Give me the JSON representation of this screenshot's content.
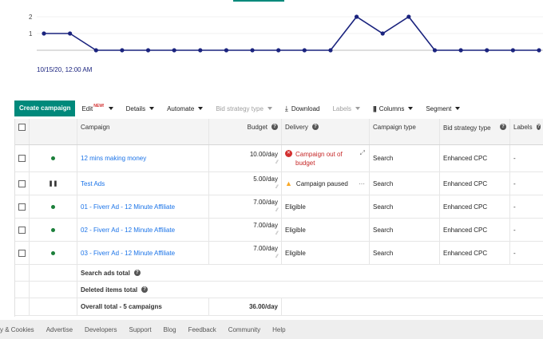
{
  "chart": {
    "y_ticks": [
      "2",
      "1"
    ],
    "values": [
      1,
      1,
      0,
      0,
      0,
      0,
      0,
      0,
      0,
      0,
      0,
      0,
      2,
      1,
      2,
      0,
      0,
      0,
      0,
      0
    ],
    "date_label": "10/15/20, 12:00 AM",
    "line_color": "#1a237e"
  },
  "toolbar": {
    "create_label": "Create campaign",
    "edit_label": "Edit",
    "edit_badge": "NEW!",
    "details_label": "Details",
    "automate_label": "Automate",
    "bid_strategy_label": "Bid strategy type",
    "download_label": "Download",
    "labels_label": "Labels",
    "columns_label": "Columns",
    "segment_label": "Segment"
  },
  "table": {
    "headers": {
      "campaign": "Campaign",
      "budget": "Budget",
      "delivery": "Delivery",
      "type": "Campaign type",
      "bid": "Bid strategy type",
      "labels": "Labels"
    },
    "rows": [
      {
        "name": "12 mins making money",
        "budget": "10.00/day",
        "delivery": "Campaign out of budget",
        "type": "Search",
        "bid": "Enhanced CPC",
        "labels": "-"
      },
      {
        "name": "Test Ads",
        "budget": "5.00/day",
        "delivery": "Campaign paused",
        "type": "Search",
        "bid": "Enhanced CPC",
        "labels": "-"
      },
      {
        "name": "01 - Fiverr Ad - 12 Minute Affiliate",
        "budget": "7.00/day",
        "delivery": "Eligible",
        "type": "Search",
        "bid": "Enhanced CPC",
        "labels": "-"
      },
      {
        "name": "02 - Fiverr Ad - 12 Minute Affiliate",
        "budget": "7.00/day",
        "delivery": "Eligible",
        "type": "Search",
        "bid": "Enhanced CPC",
        "labels": "-"
      },
      {
        "name": "03 - Fiverr Ad - 12 Minute Affiliate",
        "budget": "7.00/day",
        "delivery": "Eligible",
        "type": "Search",
        "bid": "Enhanced CPC",
        "labels": "-"
      }
    ],
    "summary": {
      "search_total": "Search ads total",
      "deleted_total": "Deleted items total",
      "overall_total": "Overall total - 5 campaigns",
      "overall_budget": "36.00/day"
    }
  },
  "footer": {
    "links": [
      "y & Cookies",
      "Advertise",
      "Developers",
      "Support",
      "Blog",
      "Feedback",
      "Community",
      "Help"
    ]
  }
}
